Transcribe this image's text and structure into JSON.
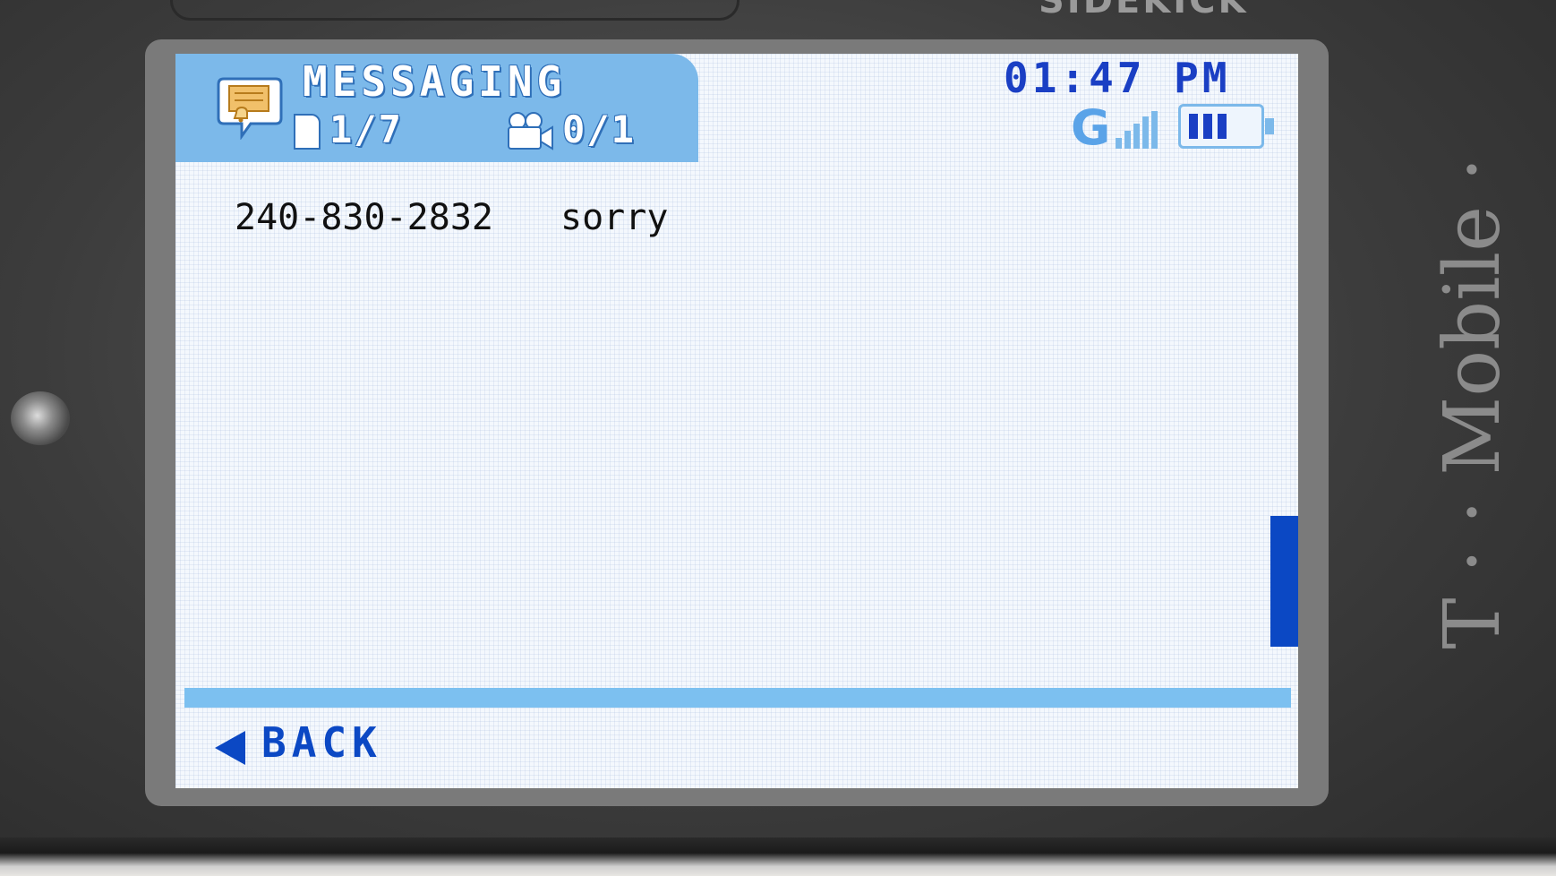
{
  "device": {
    "brand_top": "SIDEKICK",
    "brand_side": "T · · Mobile ·"
  },
  "header": {
    "app_name": "MESSAGING",
    "message_count": "1/7",
    "media_count": "0/1"
  },
  "status": {
    "time": "01:47 PM",
    "network": "G",
    "signal_icon": "signal-bars-icon",
    "battery_icon": "battery-icon"
  },
  "messages": [
    {
      "sender": "240-830-2832",
      "preview": "sorry"
    }
  ],
  "footer": {
    "back_label": "BACK"
  },
  "colors": {
    "header_blue": "#7cb9ea",
    "accent_blue": "#0b48c4",
    "clock_blue": "#1a3fc4"
  }
}
